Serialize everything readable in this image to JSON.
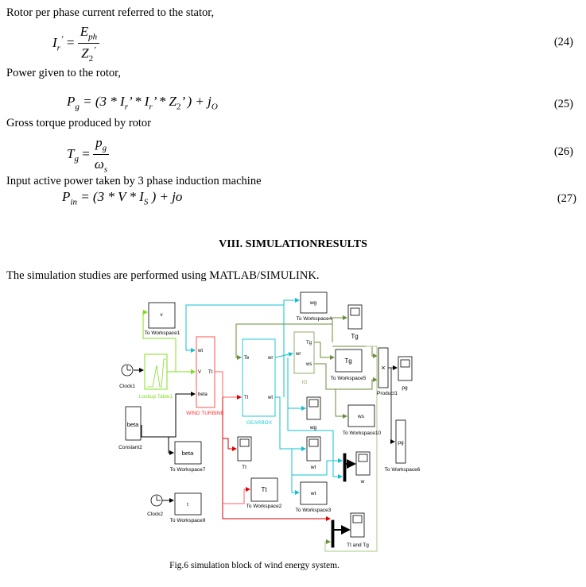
{
  "text": {
    "p1": "Rotor per phase current referred to the stator,",
    "p2": "Power given to the rotor,",
    "p3": "Gross torque produced by rotor",
    "p4": "Input active power taken by 3 phase induction machine",
    "heading": "VIII. SIMULATIONRESULTS",
    "p5": "The simulation studies are performed using MATLAB/SIMULINK.",
    "caption": "Fig.6 simulation block of wind energy system."
  },
  "equations": {
    "eq24": {
      "number": "(24)",
      "lhs": "I",
      "lhs_sub": "r",
      "prime": "’",
      "num": "E",
      "num_sub": "ph",
      "den": "Z",
      "den_sub": "2",
      "den_prime": "’"
    },
    "eq25": {
      "number": "(25)",
      "lhs": "P",
      "lhs_sub": "g",
      "body": "= (3 * I",
      "s1": "r",
      "b2": "’ * I",
      "s2": "r",
      "b3": "’ * Z",
      "s3": "2",
      "b4": "’ ) + j",
      "s4": "O"
    },
    "eq26": {
      "number": "(26)",
      "lhs": "T",
      "lhs_sub": "g",
      "num": "p",
      "num_sub": "g",
      "den": "ω",
      "den_sub": "s"
    },
    "eq27": {
      "number": "(27)",
      "lhs": "P",
      "lhs_sub": "in",
      "body": "= (3 * V * I",
      "s1": "S",
      "b2": " ) + jo"
    }
  },
  "diagram": {
    "colors": {
      "wind_turbine": "#ff3030",
      "gearbox": "#22c8d8",
      "ig": "#6b8e3a",
      "lookup": "#80e020",
      "signal": "#000000"
    },
    "blocks": {
      "ws1": {
        "text": "v",
        "label": "To Workspace1"
      },
      "clock1": {
        "label": "Clock1"
      },
      "lookup": {
        "label": "Lookup Table1"
      },
      "turbine": {
        "label": "WIND TURBINE",
        "ports": [
          "wt",
          "V",
          "beta"
        ],
        "out": "Tt"
      },
      "gearbox": {
        "label": "GEARBOX",
        "in": [
          "Te",
          "Tt"
        ],
        "out": [
          "wr",
          "wt"
        ]
      },
      "ig": {
        "label": "IG",
        "in": "wr",
        "out": [
          "Tg",
          "ws"
        ]
      },
      "ws4": {
        "text": "wg",
        "label": "To Workspace4"
      },
      "scope_tg": {
        "label": "Tg"
      },
      "ws5": {
        "text": "Tg",
        "label": "To Workspace5"
      },
      "product": {
        "text": "×",
        "label": "Product1"
      },
      "scope_pg": {
        "label": "pg"
      },
      "ws6": {
        "text": "pg",
        "label": "To Workspace6"
      },
      "ws10": {
        "text": "ws",
        "label": "To Workspace10"
      },
      "scope_wg": {
        "label": "wg"
      },
      "const2": {
        "text": "beta",
        "label": "Constant2"
      },
      "ws7": {
        "text": "beta",
        "label": "To Workspace7"
      },
      "scope_tt": {
        "label": "Tt"
      },
      "scope_wt": {
        "label": "wt"
      },
      "scope_w": {
        "label": "w"
      },
      "ws2": {
        "text": "Tt",
        "label": "To Workspace2"
      },
      "ws3": {
        "text": "wt",
        "label": "To Workspace3"
      },
      "clock2": {
        "label": "Clock2"
      },
      "ws9": {
        "text": "t",
        "label": "To Workspace9"
      },
      "scope_tttg": {
        "label": "Tt and Tg"
      }
    }
  }
}
